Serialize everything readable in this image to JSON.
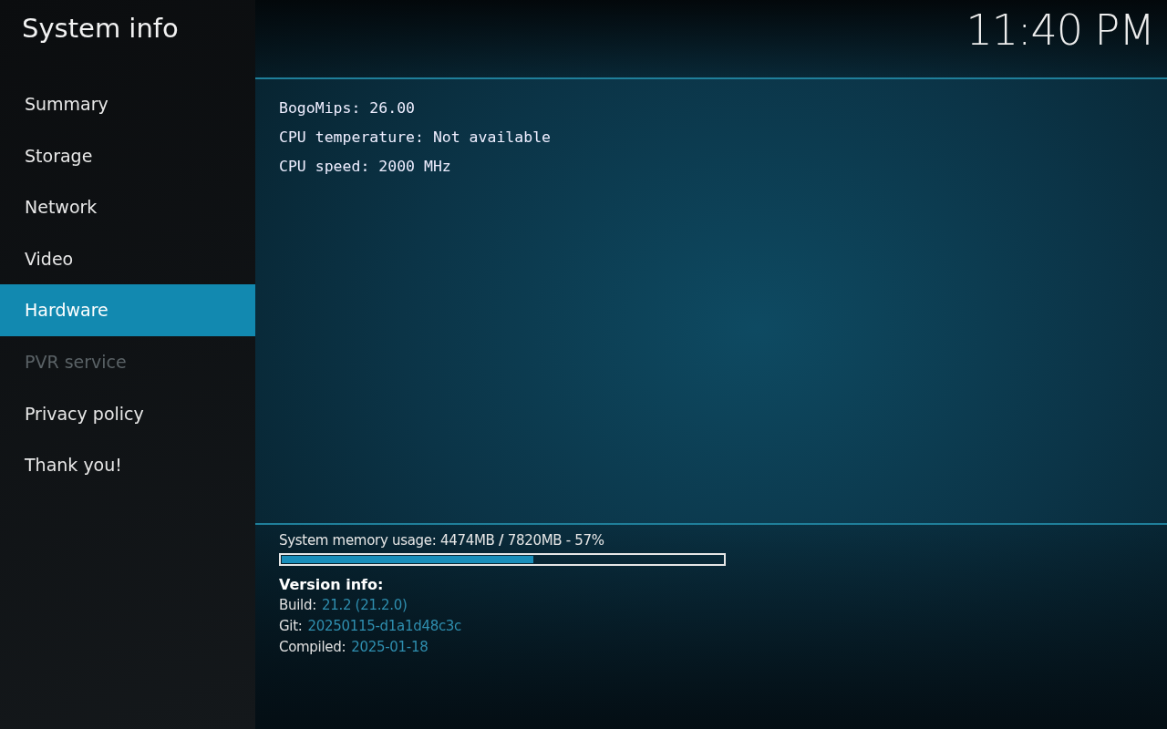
{
  "window": {
    "title": "System info",
    "clock": "11:40 PM"
  },
  "sidebar": {
    "items": [
      {
        "label": "Summary",
        "selected": false,
        "disabled": false
      },
      {
        "label": "Storage",
        "selected": false,
        "disabled": false
      },
      {
        "label": "Network",
        "selected": false,
        "disabled": false
      },
      {
        "label": "Video",
        "selected": false,
        "disabled": false
      },
      {
        "label": "Hardware",
        "selected": true,
        "disabled": false
      },
      {
        "label": "PVR service",
        "selected": false,
        "disabled": true
      },
      {
        "label": "Privacy policy",
        "selected": false,
        "disabled": false
      },
      {
        "label": "Thank you!",
        "selected": false,
        "disabled": false
      }
    ]
  },
  "details": [
    "BogoMips: 26.00",
    "CPU temperature: Not available",
    "CPU speed: 2000 MHz"
  ],
  "memory": {
    "text": "System memory usage: 4474MB **/** 7820MB - 57%",
    "level": 0.57
  },
  "version": {
    "heading": "Version info:",
    "fields": [
      {
        "label": "Build:",
        "value": "21.2 (21.2.0)"
      },
      {
        "label": "Git:",
        "value": "20250115-d1a1d48c3c"
      },
      {
        "label": "Compiled:",
        "value": "2025-01-18"
      }
    ]
  }
}
